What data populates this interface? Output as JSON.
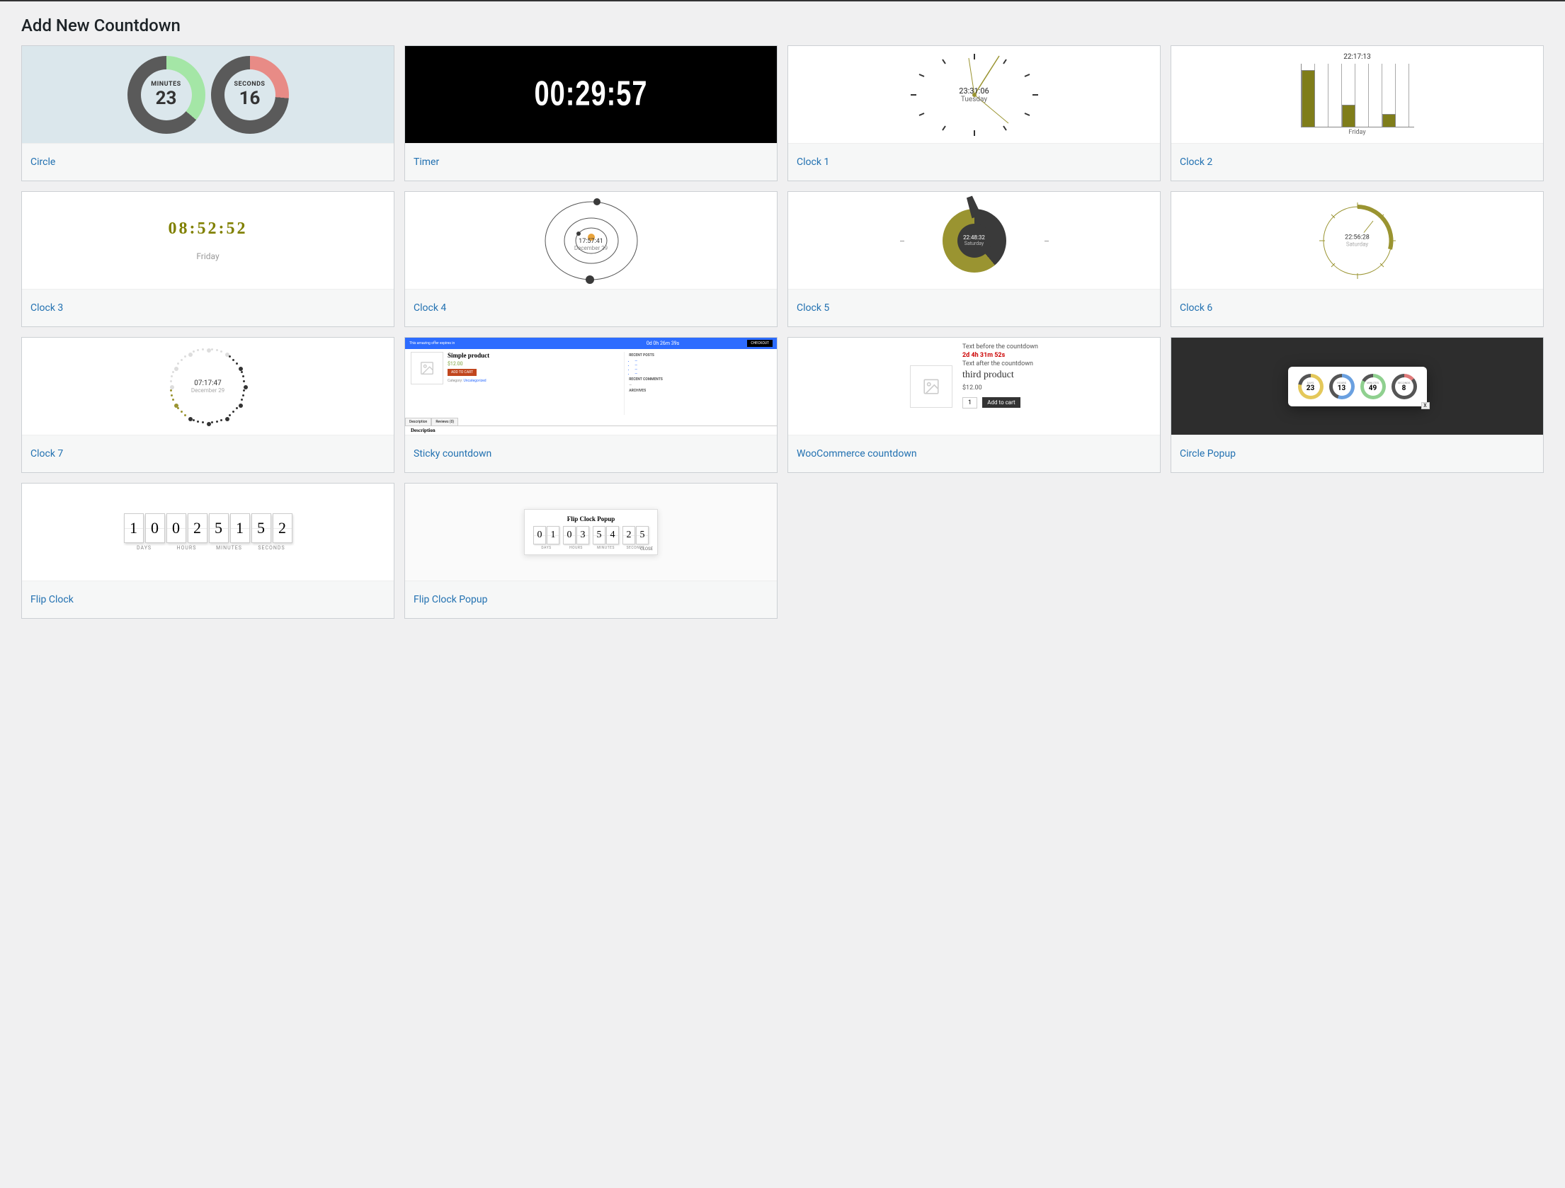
{
  "page_title": "Add New Countdown",
  "cards": {
    "circle": {
      "label": "Circle"
    },
    "timer": {
      "label": "Timer"
    },
    "clock1": {
      "label": "Clock 1"
    },
    "clock2": {
      "label": "Clock 2"
    },
    "clock3": {
      "label": "Clock 3"
    },
    "clock4": {
      "label": "Clock 4"
    },
    "clock5": {
      "label": "Clock 5"
    },
    "clock6": {
      "label": "Clock 6"
    },
    "clock7": {
      "label": "Clock 7"
    },
    "sticky": {
      "label": "Sticky countdown"
    },
    "woo": {
      "label": "WooCommerce countdown"
    },
    "cpopup": {
      "label": "Circle Popup"
    },
    "flip": {
      "label": "Flip Clock"
    },
    "flippop": {
      "label": "Flip Clock Popup"
    }
  },
  "thumbs": {
    "circle": {
      "minutes_lbl": "MINUTES",
      "minutes_val": "23",
      "seconds_lbl": "SECONDS",
      "seconds_val": "16"
    },
    "timer": {
      "display": "00:29:57"
    },
    "clock1": {
      "time": "23:31:06",
      "day": "Tuesday"
    },
    "clock2": {
      "time": "22:17:13",
      "day": "Friday"
    },
    "clock3": {
      "time": "08:52:52",
      "day": "Friday"
    },
    "clock4": {
      "time": "17:57:41",
      "date": "December 29"
    },
    "clock5": {
      "time": "22:48:32",
      "day": "Saturday"
    },
    "clock6": {
      "time": "22:56:28",
      "day": "Saturday"
    },
    "clock7": {
      "time": "07:17:47",
      "date": "December 29"
    },
    "sticky": {
      "bar_text": "This amazing offer expires in",
      "bar_time": "0d 0h 26m 39s",
      "bar_btn": "CHECKOUT",
      "product_title": "Simple product",
      "price": "$12.00",
      "add_btn": "ADD TO CART",
      "category_lbl": "Category:",
      "category_val": "Uncategorized",
      "recent_posts_h": "RECENT POSTS",
      "recent_comments_h": "RECENT COMMENTS",
      "archives_h": "ARCHIVES",
      "tab_desc": "Description",
      "tab_rev": "Reviews (0)",
      "desc_h": "Description"
    },
    "woo": {
      "before": "Text before the countdown",
      "countdown": "2d 4h 31m 52s",
      "after": "Text after the countdown",
      "product": "third product",
      "price": "$12.00",
      "qty": "1",
      "add_btn": "Add to cart"
    },
    "cpopup": {
      "days_lbl": "DAYS",
      "days_val": "23",
      "hours_lbl": "HOURS",
      "hours_val": "13",
      "minutes_lbl": "MINUTES",
      "minutes_val": "49",
      "seconds_lbl": "SECONDS",
      "seconds_val": "8",
      "close": "X"
    },
    "flip": {
      "days_lbl": "DAYS",
      "d1": "1",
      "d2": "0",
      "hours_lbl": "HOURS",
      "h1": "0",
      "h2": "2",
      "minutes_lbl": "MINUTES",
      "m1": "5",
      "m2": "1",
      "seconds_lbl": "SECONDS",
      "s1": "5",
      "s2": "2"
    },
    "flippop": {
      "title": "Flip Clock Popup",
      "days_lbl": "DAYS",
      "d1": "0",
      "d2": "1",
      "hours_lbl": "HOURS",
      "h1": "0",
      "h2": "3",
      "minutes_lbl": "MINUTES",
      "m1": "5",
      "m2": "4",
      "seconds_lbl": "SECONDS",
      "s1": "2",
      "s2": "5",
      "close": "CLOSE"
    }
  }
}
